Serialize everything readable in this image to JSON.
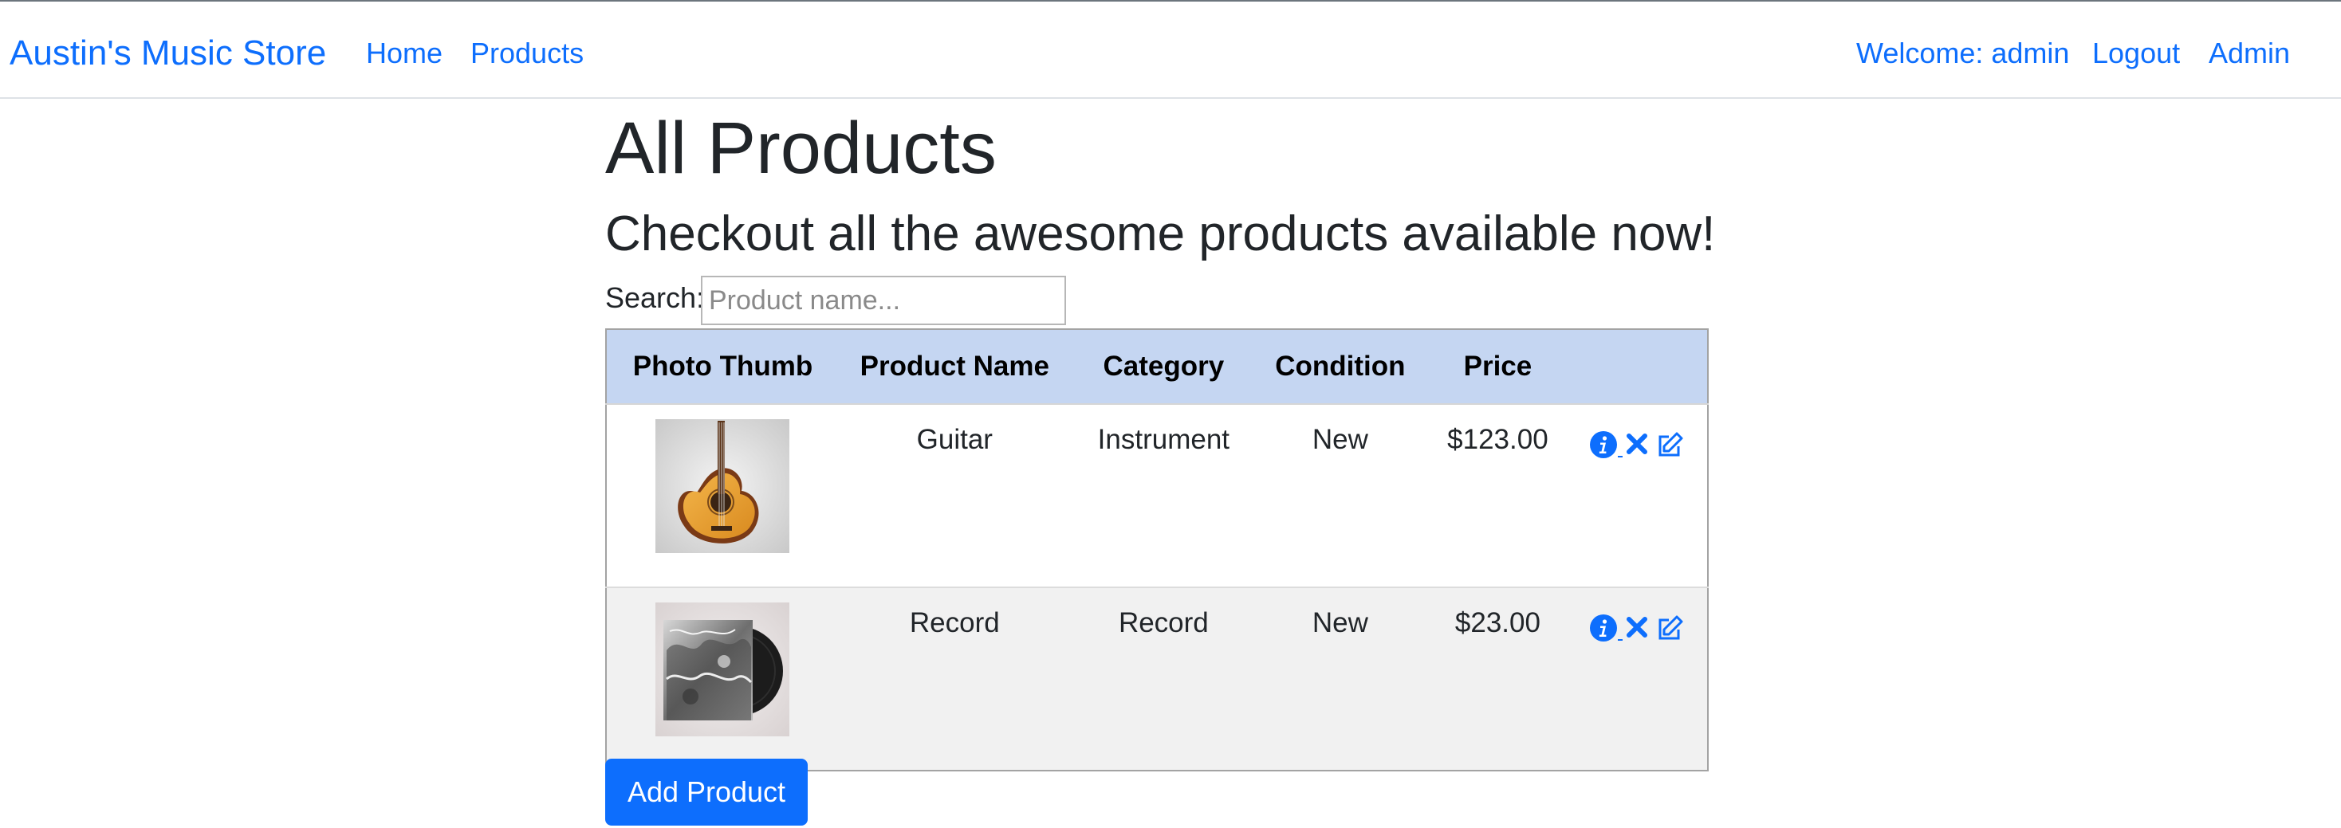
{
  "nav": {
    "brand": "Austin's Music Store",
    "links": [
      {
        "label": "Home"
      },
      {
        "label": "Products"
      }
    ],
    "welcome": "Welcome: admin",
    "logout": "Logout",
    "admin": "Admin"
  },
  "page": {
    "title": "All Products",
    "subtitle": "Checkout all the awesome products available now!"
  },
  "search": {
    "label": "Search:",
    "value": "",
    "placeholder": "Product name..."
  },
  "table": {
    "headers": [
      "Photo Thumb",
      "Product Name",
      "Category",
      "Condition",
      "Price",
      ""
    ],
    "rows": [
      {
        "thumb": "guitar-image",
        "name": "Guitar",
        "category": "Instrument",
        "condition": "New",
        "price": "$123.00"
      },
      {
        "thumb": "record-image",
        "name": "Record",
        "category": "Record",
        "condition": "New",
        "price": "$23.00"
      }
    ],
    "action_icons": [
      "info-icon",
      "delete-x-icon",
      "edit-icon"
    ]
  },
  "add_button": "Add Product",
  "colors": {
    "accent": "#0d6efd",
    "header_bg": "#c5d6f2",
    "stripe_bg": "#f1f1f1"
  }
}
